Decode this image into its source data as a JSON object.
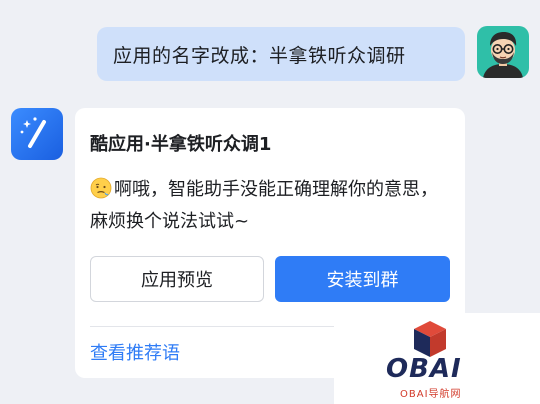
{
  "conversation": {
    "user_message": "应用的名字改成：半拿铁听众调研",
    "bot_card": {
      "title": "酷应用·半拿铁听众调1",
      "body_text": "啊哦，智能助手没能正确理解你的意思，麻烦换个说法试试~",
      "preview_button": "应用预览",
      "install_button": "安装到群",
      "suggestion_link": "查看推荐语"
    }
  },
  "watermark": {
    "logo_text": "OBAI",
    "sub_text": "OBAI导航网"
  },
  "colors": {
    "background": "#eef0f5",
    "user_bubble": "#cfe0fa",
    "accent_blue": "#2f7cf6",
    "card": "#ffffff"
  },
  "icons": {
    "user_avatar": "cartoon-man-avatar",
    "bot_avatar": "magic-wand-icon",
    "emoji": "confused-face-emoji"
  }
}
